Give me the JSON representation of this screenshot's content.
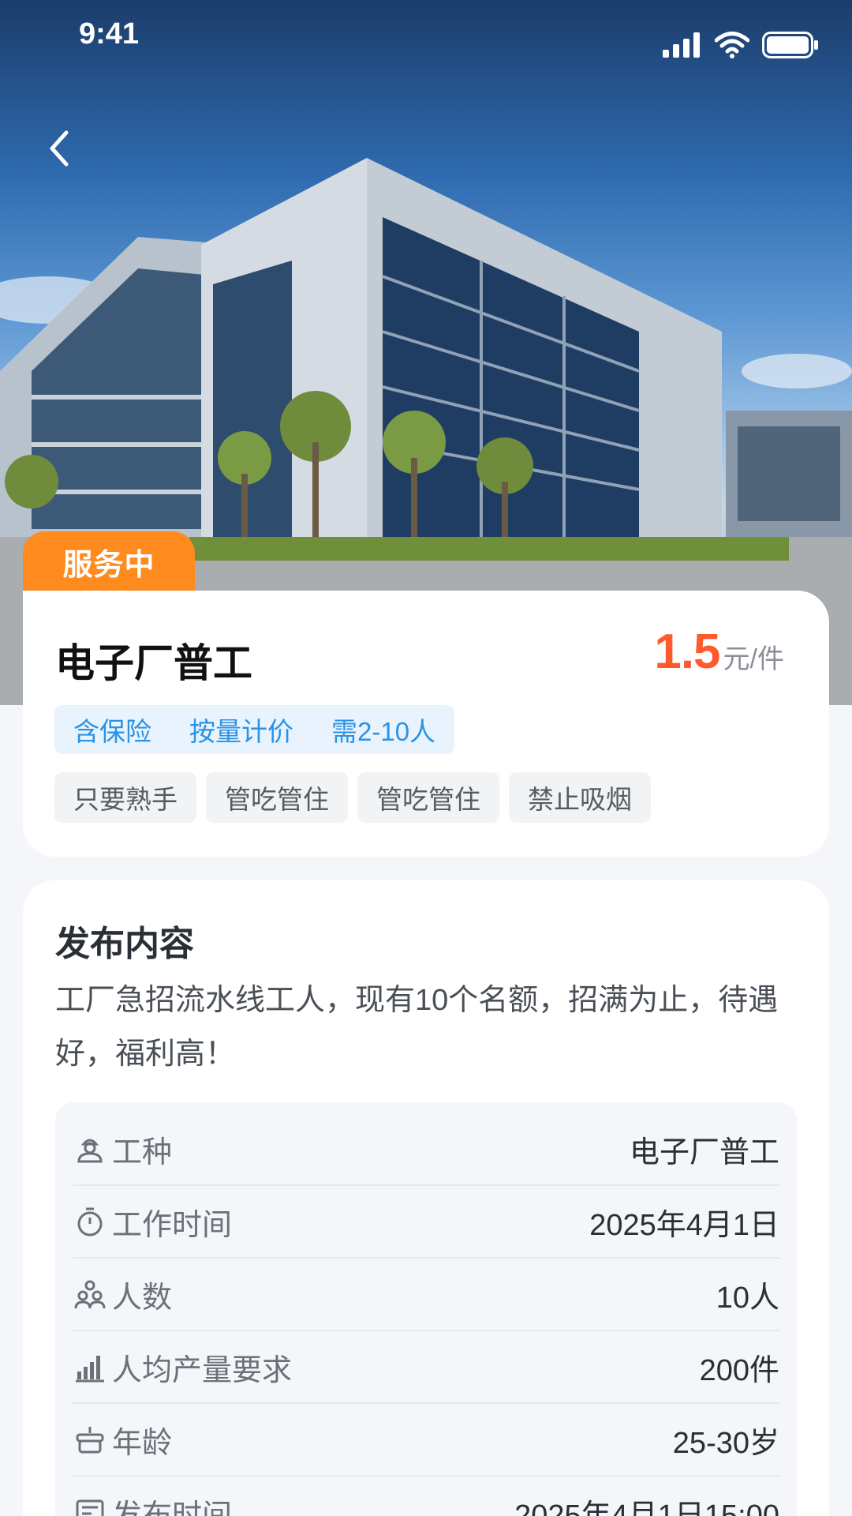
{
  "status_bar": {
    "time": "9:41"
  },
  "hero": {
    "badge": "服务中"
  },
  "job": {
    "title": "电子厂普工",
    "price_value": "1.5",
    "price_unit": "元/件",
    "tags_primary": [
      "含保险",
      "按量计价",
      "需2-10人"
    ],
    "tags_secondary": [
      "只要熟手",
      "管吃管住",
      "管吃管住",
      "禁止吸烟"
    ]
  },
  "content": {
    "section_title": "发布内容",
    "description": "工厂急招流水线工人，现有10个名额，招满为止，待遇好，福利高！",
    "details": [
      {
        "icon": "worker-icon",
        "label": "工种",
        "value": "电子厂普工"
      },
      {
        "icon": "stopwatch-icon",
        "label": "工作时间",
        "value": "2025年4月1日"
      },
      {
        "icon": "people-icon",
        "label": "人数",
        "value": "10人"
      },
      {
        "icon": "bar-chart-icon",
        "label": "人均产量要求",
        "value": "200件"
      },
      {
        "icon": "cake-icon",
        "label": "年龄",
        "value": "25-30岁"
      },
      {
        "icon": "publish-icon",
        "label": "发布时间",
        "value": "2025年4月1日15:00"
      }
    ]
  },
  "colors": {
    "accent_orange": "#ff8a1e",
    "price_red": "#ff5a2c",
    "tag_blue": "#2a93e6",
    "page_background": "#f4f6fa"
  }
}
